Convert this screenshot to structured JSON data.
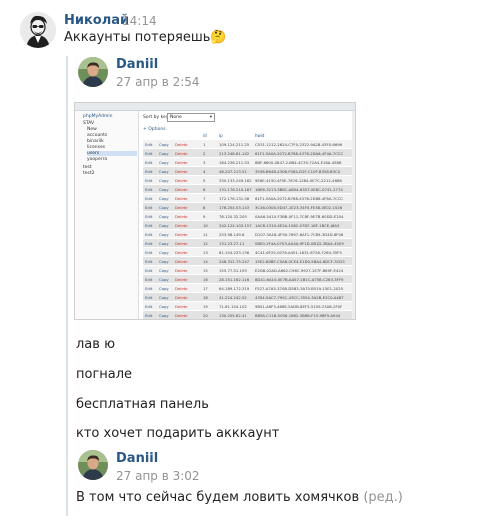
{
  "messages": [
    {
      "author": "Николай",
      "time": "14:14",
      "text": "Аккаунты потеряешь",
      "emoji": "🤔"
    },
    {
      "author": "Daniil",
      "time": "27 апр в 2:54"
    },
    {
      "text": "лав ю"
    },
    {
      "text": "погнале"
    },
    {
      "text": "бесплатная панель"
    },
    {
      "text": "кто хочет подарить акккаунт"
    },
    {
      "author": "Daniil",
      "time": "27 апр в 3:02",
      "text": "В том что сейчас будем ловить хомячков",
      "edited": "(ред.)"
    }
  ],
  "screenshot": {
    "tree": [
      "phpMyAdmin",
      "STAV",
      "New",
      "accounts",
      "binarilk",
      "licenses",
      "users",
      "yooperra",
      "test",
      "test2"
    ],
    "sort_label": "Sort by key:",
    "sort_value": "None",
    "options_label": "+ Options",
    "columns": [
      "id",
      "ip",
      "hwid"
    ],
    "row_actions": {
      "edit": "Edit",
      "copy": "Copy",
      "delete": "Delete"
    },
    "rows": [
      {
        "id": "1",
        "ip": "109.124.211.25",
        "hwid": "C531-1212-2624-C7F0-2322-9A28-43F0-6696"
      },
      {
        "id": "2",
        "ip": "213.248.61.142",
        "hwid": "61F1-5A0A-2072-B768-4376-2DA6-4F4A-7CCC"
      },
      {
        "id": "3",
        "ip": "164.236.211.53",
        "hwid": "8BF-6600-0847-2-B84-4C35-72A4-E16A-4588"
      },
      {
        "id": "4",
        "ip": "46.207.213.51",
        "hwid": "3558-B64B-4306-F084-D2F-C10F-B358-B3C0"
      },
      {
        "id": "5",
        "ip": "330.133.249.182",
        "hwid": "9E6E-4150-4F5E-7876-1284-0E7C-2212-4686"
      },
      {
        "id": "6",
        "ip": "131.176.210.187",
        "hwid": "1BE6-3213-3B8C-A804-6357-0E8C-0741-2774"
      },
      {
        "id": "7",
        "ip": "172.176.131.58",
        "hwid": "61F1-5A0A-2072-B768-4376-2D86-4F6A-7CCC"
      },
      {
        "id": "8",
        "ip": "176.254.53.143",
        "hwid": "3C46-0300-5D47-1E23-34F0-FE38-0E02-1526"
      },
      {
        "id": "9",
        "ip": "78.120.32.205",
        "hwid": "0AA6-5410-F3BB-0F11-7C8F-9E7B-60DD-E204"
      },
      {
        "id": "10",
        "ip": "242.124.103.157",
        "hwid": "1AC8-1310-4E2A-1062-07DF-18F-1BCE-J6A3"
      },
      {
        "id": "11",
        "ip": "253.98.149.6",
        "hwid": "D107-3A18-4F90-7697-6AF1-7C89-3D4D-6F06"
      },
      {
        "id": "12",
        "ip": "131.23.27.11",
        "hwid": "0BE0-2F4A-0703-AA4A-9F1D-0B1D-3BA4-4509"
      },
      {
        "id": "13",
        "ip": "81.154.233.136",
        "hwid": "4C41-6F25-0076-A451-1631-6726-7264-35F5"
      },
      {
        "id": "14",
        "ip": "248.312.75.247",
        "hwid": "15E2-B0BF-C5A6-0CE4-E1D0-5BA4-6DCF-3CD3"
      },
      {
        "id": "15",
        "ip": "155.77.51.193",
        "hwid": "E2D8-02AD-A662-C96C-9927-1E7F-B69F-E424"
      },
      {
        "id": "16",
        "ip": "28.151.162.116",
        "hwid": "8D41-6A10-0E7B-AA57-1B1C-A758-C263-3FF9"
      },
      {
        "id": "17",
        "ip": "64.189.172.319",
        "hwid": "F527-A7A5-370B-D5B3-3A75-B519-15E1-2025"
      },
      {
        "id": "18",
        "ip": "41.224.242.52",
        "hwid": "4354-5AC7-795C-43CC-3554-3A2B-E2C0-A487"
      },
      {
        "id": "19",
        "ip": "71.61.154.102",
        "hwid": "9B51-A6F3-466E-5ADB-8EF3-5109-23A6-2F0F"
      },
      {
        "id": "20",
        "ip": "130.255.62.41",
        "hwid": "B858-C11B-5056-1662-3B6B-F15-9BF9-A944"
      }
    ]
  }
}
